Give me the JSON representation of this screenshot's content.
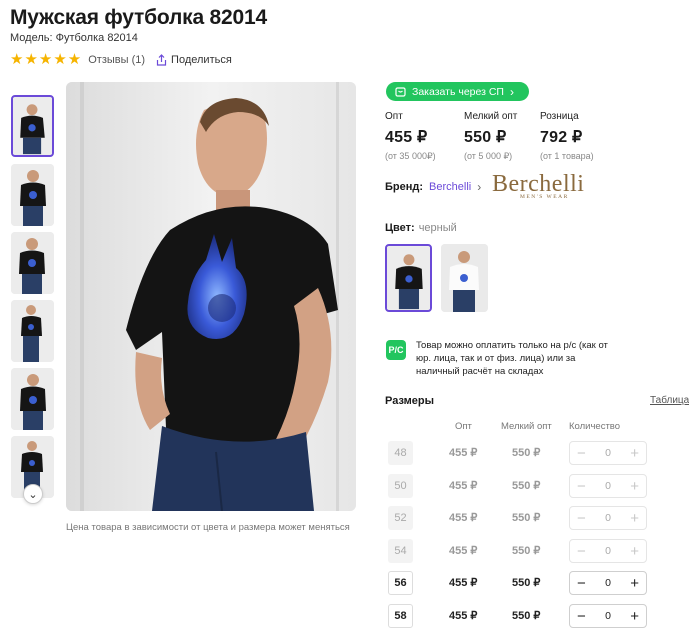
{
  "product": {
    "title": "Мужская футболка 82014",
    "model": "Модель: Футболка 82014",
    "stars": "★★★★★",
    "reviews": "Отзывы (1)",
    "share": "Поделиться",
    "price_note": "Цена товара в зависимости от цвета и размера может меняться"
  },
  "sp_button": {
    "label": "Заказать через СП",
    "icon": "cart-icon"
  },
  "prices": [
    {
      "label": "Опт",
      "value": "455 ₽",
      "sub": "(от 35 000₽)"
    },
    {
      "label": "Мелкий опт",
      "value": "550 ₽",
      "sub": "(от 5 000 ₽)"
    },
    {
      "label": "Розница",
      "value": "792 ₽",
      "sub": "(от 1 товара)"
    }
  ],
  "brand": {
    "label": "Бренд:",
    "name": "Berchelli",
    "logo_word": "Berchelli",
    "logo_sub": "MEN'S WEAR"
  },
  "color": {
    "label": "Цвет:",
    "value": "черный"
  },
  "payment": {
    "icon_text": "Р/С",
    "text": "Товар можно оплатить только на р/с (как от юр. лица, так и от физ. лица) или за наличный расчёт на складах"
  },
  "sizes": {
    "title": "Размеры",
    "table_link": "Таблица",
    "headers": {
      "opt": "Опт",
      "small": "Мелкий опт",
      "qty": "Количество"
    },
    "rows": [
      {
        "size": "48",
        "opt": "455 ₽",
        "small": "550 ₽",
        "qty": "0",
        "available": false
      },
      {
        "size": "50",
        "opt": "455 ₽",
        "small": "550 ₽",
        "qty": "0",
        "available": false
      },
      {
        "size": "52",
        "opt": "455 ₽",
        "small": "550 ₽",
        "qty": "0",
        "available": false
      },
      {
        "size": "54",
        "opt": "455 ₽",
        "small": "550 ₽",
        "qty": "0",
        "available": false
      },
      {
        "size": "56",
        "opt": "455 ₽",
        "small": "550 ₽",
        "qty": "0",
        "available": true
      },
      {
        "size": "58",
        "opt": "455 ₽",
        "small": "550 ₽",
        "qty": "0",
        "available": true
      }
    ]
  },
  "colors": {
    "accent": "#6b4ad8",
    "green": "#22c55e",
    "star": "#f6b400"
  }
}
